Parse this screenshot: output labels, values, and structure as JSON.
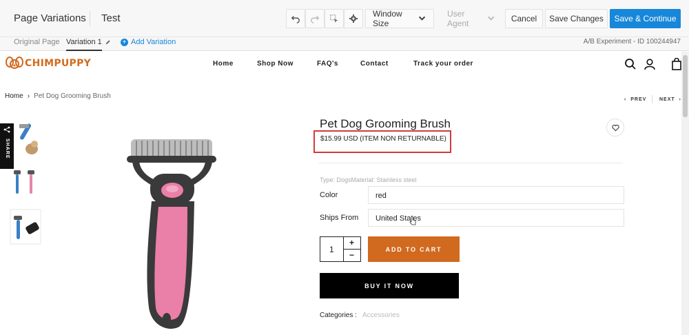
{
  "editor": {
    "title": "Page Variations",
    "test_name": "Test",
    "window_size": "Window Size",
    "user_agent": "User Agent",
    "cancel": "Cancel",
    "save": "Save Changes",
    "save_continue": "Save & Continue",
    "tabs": [
      "Original Page",
      "Variation 1"
    ],
    "add_variation": "Add Variation",
    "experiment": "A/B Experiment - ID 100244947",
    "accent": "#1787d9"
  },
  "site": {
    "logo": "CHIMPUPPY",
    "nav": [
      "Home",
      "Shop Now",
      "FAQ's",
      "Contact",
      "Track your order"
    ],
    "brand_color": "#d1691f"
  },
  "breadcrumb": {
    "home": "Home",
    "current": "Pet Dog Grooming Brush"
  },
  "pager": {
    "prev": "PREV",
    "next": "NEXT"
  },
  "share": "SHARE",
  "product": {
    "title": "Pet Dog Grooming Brush",
    "price": "$15.99 USD (ITEM NON RETURNABLE)",
    "meta": "Type: DogsMaterial: Stainless steel",
    "color_label": "Color",
    "color_value": "red",
    "ships_label": "Ships From",
    "ships_value": "United States",
    "qty": "1",
    "qty_plus": "+",
    "qty_minus": "−",
    "add_to_cart": "ADD TO CART",
    "buy_now": "BUY IT NOW",
    "categories_label": "Categories :",
    "categories_value": "Accessories"
  }
}
